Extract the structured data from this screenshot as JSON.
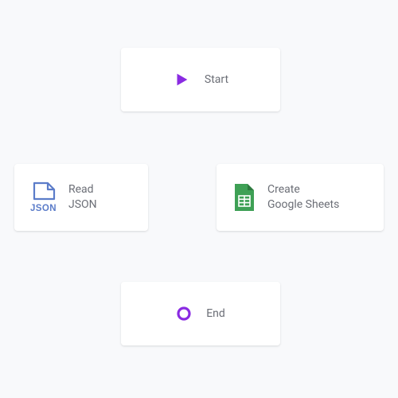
{
  "nodes": {
    "start": {
      "label": "Start",
      "icon": "play-icon"
    },
    "readJson": {
      "label": "Read\nJSON",
      "icon": "json-icon"
    },
    "createSheets": {
      "label": "Create\nGoogle Sheets",
      "icon": "sheets-icon"
    },
    "end": {
      "label": "End",
      "icon": "circle-icon"
    }
  },
  "colors": {
    "purple": "#8a2be2",
    "json": "#5b7cc9",
    "sheets": "#3ea055"
  }
}
